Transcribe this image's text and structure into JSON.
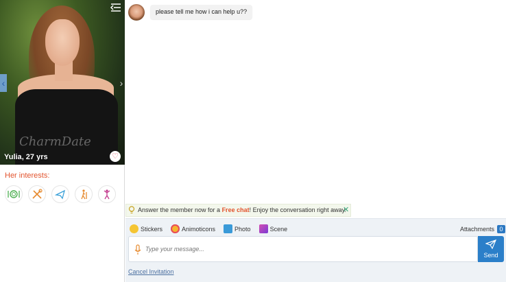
{
  "profile": {
    "name": "Yulia",
    "age": ", 27 yrs",
    "watermark": "CharmDate",
    "interests_label": "Her interests:",
    "interests": [
      "dining-icon",
      "cooking-icon",
      "travel-icon",
      "hiking-icon",
      "dancing-icon"
    ]
  },
  "chat": {
    "messages": [
      {
        "text": "please tell me how i can help u??"
      }
    ],
    "tip": {
      "before": "Answer the member now for a ",
      "highlight": "Free chat",
      "after": "! Enjoy the conversation right away."
    },
    "toolbar": {
      "stickers": "Stickers",
      "animoticons": "Animoticons",
      "photo": "Photo",
      "scene": "Scene"
    },
    "attachments_label": "Attachments",
    "attachments_count": "0",
    "input_placeholder": "Type your message...",
    "send_label": "Send",
    "cancel_label": "Cancel Invitation"
  },
  "colors": {
    "accent": "#2b7fc9",
    "highlight": "#e2532d",
    "tip_bg": "#f3f7ec"
  }
}
